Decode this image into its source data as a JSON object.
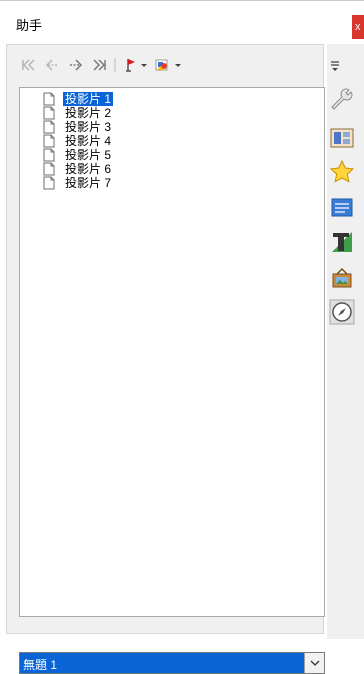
{
  "window": {
    "title": "助手",
    "close_label": "x"
  },
  "toolbar": {
    "buttons": [
      {
        "icon": "first-slide-icon",
        "enabled": false
      },
      {
        "icon": "previous-slide-icon",
        "enabled": false
      },
      {
        "icon": "next-slide-icon",
        "enabled": true
      },
      {
        "icon": "last-slide-icon",
        "enabled": true
      },
      {
        "icon": "drag-mode-icon",
        "enabled": true
      },
      {
        "icon": "shapes-icon",
        "enabled": true
      }
    ]
  },
  "tree": {
    "items": [
      {
        "label": "投影片 1",
        "selected": true
      },
      {
        "label": "投影片 2",
        "selected": false
      },
      {
        "label": "投影片 3",
        "selected": false
      },
      {
        "label": "投影片 4",
        "selected": false
      },
      {
        "label": "投影片 5",
        "selected": false
      },
      {
        "label": "投影片 6",
        "selected": false
      },
      {
        "label": "投影片 7",
        "selected": false
      }
    ]
  },
  "document_select": {
    "value": "無題 1"
  },
  "deck": {
    "buttons": [
      {
        "icon": "menu-icon"
      },
      {
        "icon": "properties-icon"
      },
      {
        "icon": "master-slides-icon"
      },
      {
        "icon": "animation-star-icon"
      },
      {
        "icon": "slide-transition-icon"
      },
      {
        "icon": "styles-icon"
      },
      {
        "icon": "gallery-icon"
      },
      {
        "icon": "navigator-icon"
      }
    ]
  },
  "colors": {
    "selection": "#0a64d6",
    "close_button": "#d9362e",
    "panel_background": "#f0f0f0"
  }
}
